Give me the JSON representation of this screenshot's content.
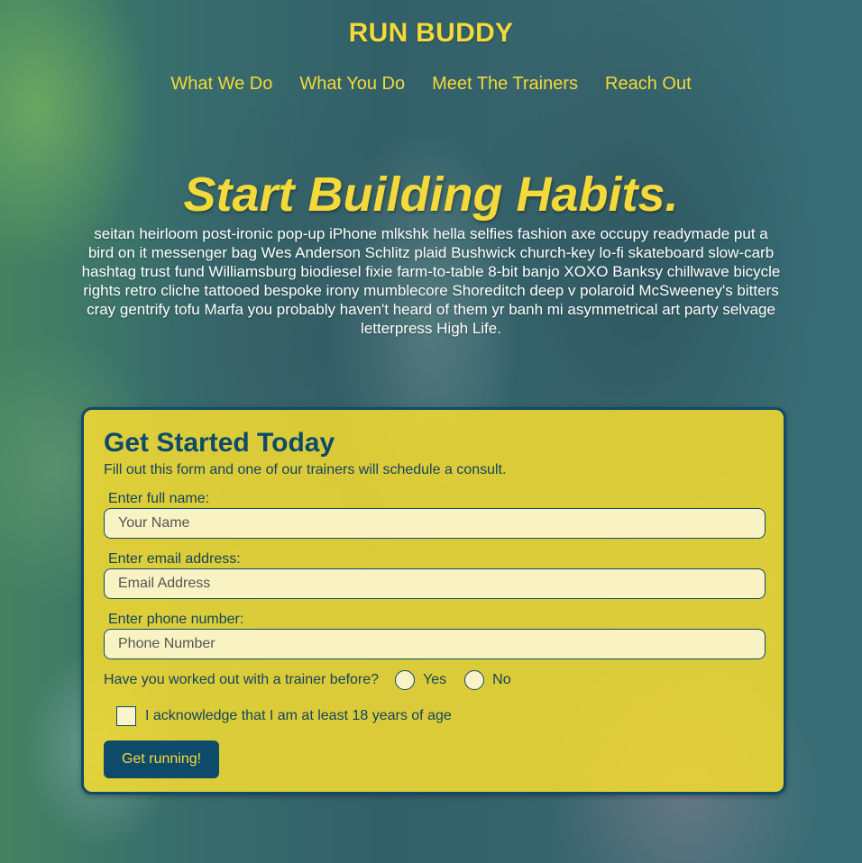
{
  "header": {
    "brand": "RUN BUDDY",
    "nav": [
      {
        "label": "What We Do"
      },
      {
        "label": "What You Do"
      },
      {
        "label": "Meet The Trainers"
      },
      {
        "label": "Reach Out"
      }
    ]
  },
  "hero": {
    "title": "Start Building Habits.",
    "body": "seitan heirloom post-ironic pop-up iPhone mlkshk hella selfies fashion axe occupy readymade put a bird on it messenger bag Wes Anderson Schlitz plaid Bushwick church-key lo-fi skateboard slow-carb hashtag trust fund Williamsburg biodiesel fixie farm-to-table 8-bit banjo XOXO Banksy chillwave bicycle rights retro cliche tattooed bespoke irony mumblecore Shoreditch deep v polaroid McSweeney's bitters cray gentrify tofu Marfa you probably haven't heard of them yr banh mi asymmetrical art party selvage letterpress High Life."
  },
  "form": {
    "title": "Get Started Today",
    "intro": "Fill out this form and one of our trainers will schedule a consult.",
    "fields": {
      "name": {
        "label": "Enter full name:",
        "placeholder": "Your Name",
        "value": ""
      },
      "email": {
        "label": "Enter email address:",
        "placeholder": "Email Address",
        "value": ""
      },
      "phone": {
        "label": "Enter phone number:",
        "placeholder": "Phone Number",
        "value": ""
      }
    },
    "trainer_question": {
      "label": "Have you worked out with a trainer before?",
      "options": [
        "Yes",
        "No"
      ]
    },
    "age_ack": "I acknowledge that I am at least 18 years of age",
    "submit_label": "Get running!"
  },
  "colors": {
    "accent_yellow": "#f4d93a",
    "navy": "#0e4b6b",
    "card_yellow": "#f7dc31"
  }
}
